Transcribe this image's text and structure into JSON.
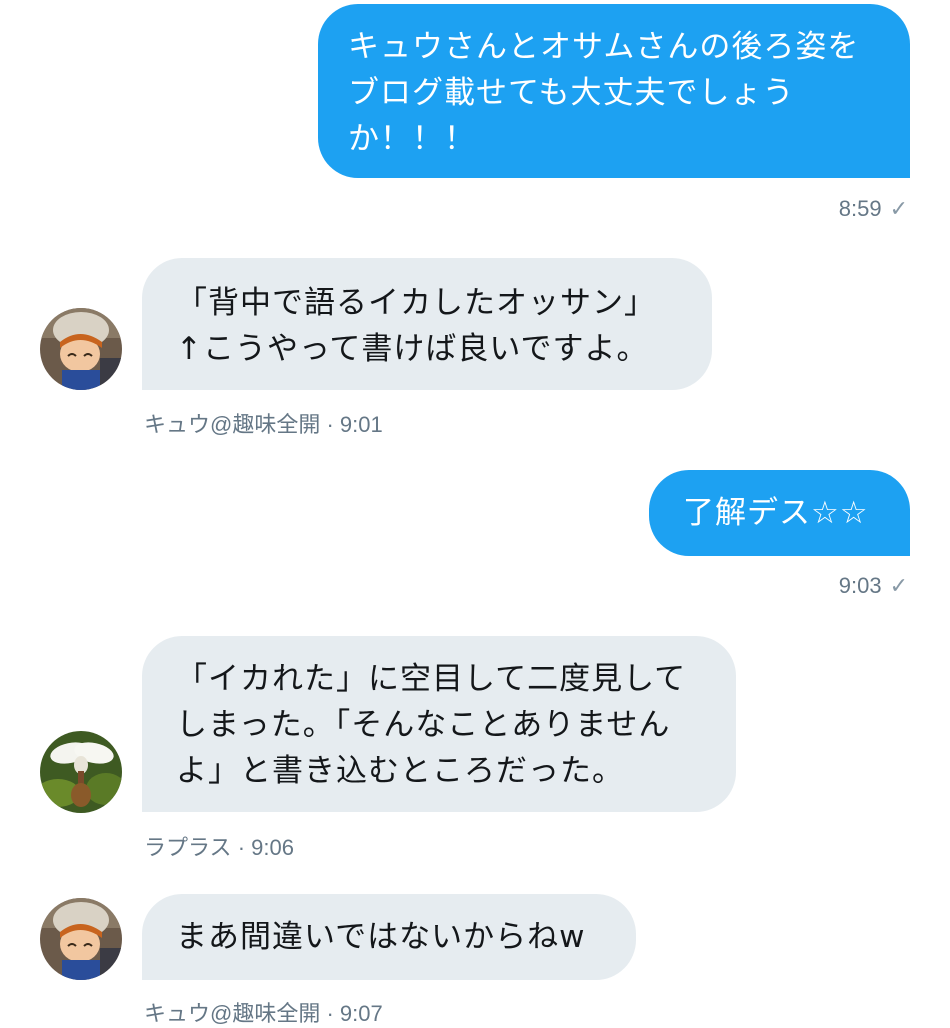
{
  "messages": [
    {
      "direction": "outgoing",
      "lines": [
        "キュウさんとオサムさんの後ろ姿を",
        "ブログ載せても大丈夫でしょう",
        "か！！！"
      ],
      "time": "8:59",
      "status": "read-check"
    },
    {
      "direction": "incoming",
      "lines": [
        "「背中で語るイカしたオッサン」",
        "↑こうやって書けば良いですよ。"
      ],
      "sender": "キュウ@趣味全開",
      "time": "· 9:01",
      "avatar": "avatar-kyu-icon"
    },
    {
      "direction": "outgoing",
      "lines": [
        "了解デス☆☆"
      ],
      "time": "9:03",
      "status": "read-check"
    },
    {
      "direction": "incoming",
      "lines": [
        "「イカれた」に空目して二度見して",
        "しまった。「そんなことありません",
        "よ」と書き込むところだった。"
      ],
      "sender": "ラプラス",
      "time": "· 9:06",
      "avatar": "avatar-laplace-icon"
    },
    {
      "direction": "incoming",
      "lines": [
        "まあ間違いではないからねw"
      ],
      "sender": "キュウ@趣味全開",
      "time": "· 9:07",
      "avatar": "avatar-kyu-icon"
    }
  ],
  "colors": {
    "outgoing_bubble": "#1da1f2",
    "incoming_bubble": "#e6ecf0",
    "meta_text": "#657786"
  }
}
